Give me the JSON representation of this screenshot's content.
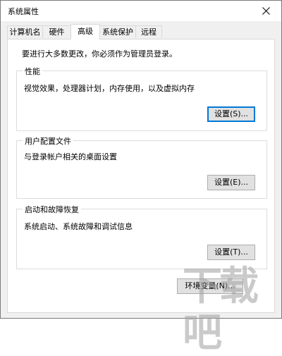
{
  "window": {
    "title": "系统属性",
    "close_icon": "close-icon"
  },
  "tabs": [
    {
      "label": "计算机名",
      "active": false
    },
    {
      "label": "硬件",
      "active": false
    },
    {
      "label": "高级",
      "active": true
    },
    {
      "label": "系统保护",
      "active": false
    },
    {
      "label": "远程",
      "active": false
    }
  ],
  "panel": {
    "notice": "要进行大多数更改，你必须作为管理员登录。",
    "performance": {
      "title": "性能",
      "description": "视觉效果，处理器计划，内存使用，以及虚拟内存",
      "button": "设置(S)..."
    },
    "user_profiles": {
      "title": "用户配置文件",
      "description": "与登录帐户相关的桌面设置",
      "button": "设置(E)..."
    },
    "startup_recovery": {
      "title": "启动和故障恢复",
      "description": "系统启动、系统故障和调试信息",
      "button": "设置(T)..."
    },
    "env_button": "环境变量(N)..."
  },
  "watermark": "下载吧"
}
